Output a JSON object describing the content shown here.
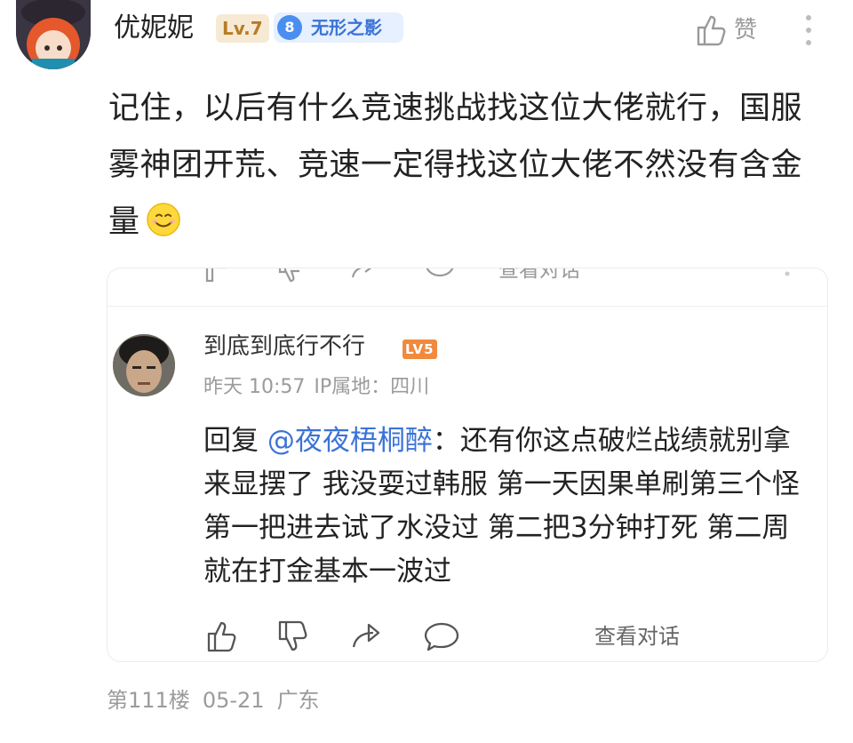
{
  "header": {
    "username": "优妮妮",
    "level_badge": "Lv.7",
    "fan_badge": {
      "level": "8",
      "name": "无形之影"
    },
    "like_label": "赞"
  },
  "post": {
    "text": "记住，以后有什么竞速挑战找这位大佬就行，国服雾神团开荒、竞速一定得找这位大佬不然没有含金量"
  },
  "reply_card": {
    "prev_action_label": "查看对话",
    "user": {
      "name": "到底到底行不行",
      "level_badge": "LV5",
      "time": "昨天 10:57",
      "ip": "IP属地：四川"
    },
    "reply_prefix": "回复 ",
    "mention": "@夜夜梧桐醉",
    "reply_text": "：还有你这点破烂战绩就别拿来显摆了  我没耍过韩服  第一天因果单刷第三个怪第一把进去试了水没过  第二把3分钟打死   第二周就在打金基本一波过",
    "action_label": "查看对话"
  },
  "footer": {
    "floor": "第111楼",
    "date": "05-21",
    "location": "广东"
  },
  "colors": {
    "mention": "#3b73d6",
    "lv_badge_bg": "#f6ead5",
    "fan_badge_bg": "#e6f0ff",
    "reply_lv_bg": "#f08a3c"
  }
}
